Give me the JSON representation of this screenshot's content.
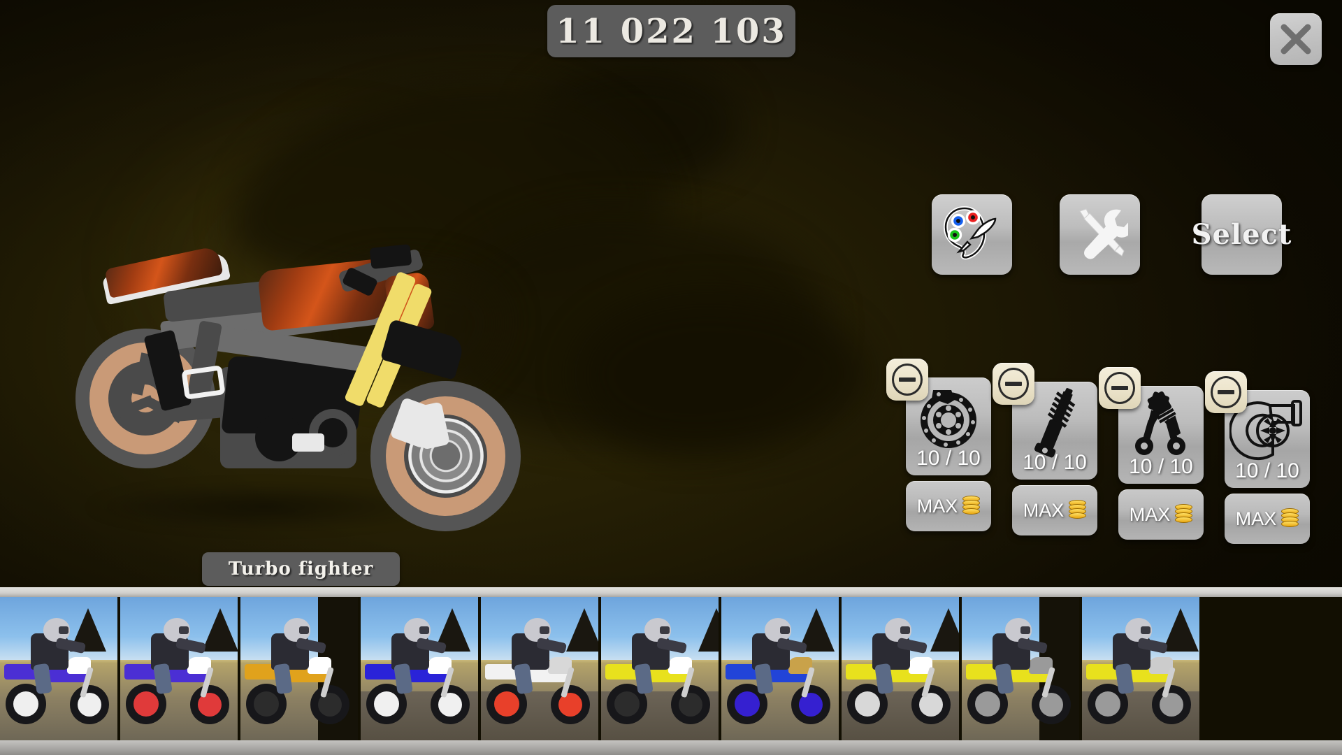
{
  "hud": {
    "money_counter": "11 022 103",
    "close_icon": "close-icon"
  },
  "actions": [
    {
      "id": "paint",
      "name": "paint-button",
      "label": "",
      "icon": "paint-palette-icon"
    },
    {
      "id": "tools",
      "name": "tools-button",
      "label": "",
      "icon": "tools-wrench-screwdriver-icon"
    },
    {
      "id": "select",
      "name": "select-button",
      "label": "Select",
      "icon": ""
    }
  ],
  "upgrades": {
    "decrement_icon": "minus-icon",
    "currency_icon": "coin-stack-icon",
    "items": [
      {
        "name": "brakes",
        "icon": "brake-disc-icon",
        "level": "10 / 10",
        "buy_label": "MAX"
      },
      {
        "name": "suspension",
        "icon": "shock-absorber-icon",
        "level": "10 / 10",
        "buy_label": "MAX"
      },
      {
        "name": "engine",
        "icon": "pistons-icon",
        "level": "10 / 10",
        "buy_label": "MAX"
      },
      {
        "name": "turbo",
        "icon": "turbocharger-icon",
        "level": "10 / 10",
        "buy_label": "MAX"
      }
    ]
  },
  "vehicle": {
    "name": "Turbo  fighter"
  },
  "garage_strip": {
    "thumbnails": [
      {
        "index": 1,
        "bike_color": "#4b2fd4",
        "accent": "#ffffff",
        "rim": "#efefef",
        "scene": "desert-day",
        "selected": false
      },
      {
        "index": 2,
        "bike_color": "#4b2fd4",
        "accent": "#ffffff",
        "rim": "#e03a3a",
        "scene": "desert-day",
        "selected": false
      },
      {
        "index": 3,
        "bike_color": "#e0a21c",
        "accent": "#ffffff",
        "rim": "#2c2c2c",
        "scene": "desert-wall",
        "selected": false
      },
      {
        "index": 4,
        "bike_color": "#2a23d8",
        "accent": "#ffffff",
        "rim": "#f0f0f0",
        "scene": "desert-road",
        "selected": false
      },
      {
        "index": 5,
        "bike_color": "#f2f2f2",
        "accent": "#d8d8d8",
        "rim": "#e8402a",
        "scene": "desert-road",
        "selected": false
      },
      {
        "index": 6,
        "bike_color": "#e8e11d",
        "accent": "#ffffff",
        "rim": "#2c2c2c",
        "scene": "desert-road",
        "selected": false
      },
      {
        "index": 7,
        "bike_color": "#2244d8",
        "accent": "#c9a24a",
        "rim": "#3520d0",
        "scene": "desert-day",
        "selected": false
      },
      {
        "index": 8,
        "bike_color": "#e8e11d",
        "accent": "#ffffff",
        "rim": "#d8d8d8",
        "scene": "desert-road",
        "selected": false
      },
      {
        "index": 9,
        "bike_color": "#e8e11d",
        "accent": "#9a9a9a",
        "rim": "#9a9a9a",
        "scene": "desert-wall",
        "selected": false
      },
      {
        "index": 10,
        "bike_color": "#e8e11d",
        "accent": "#cccccc",
        "rim": "#9a9a9a",
        "scene": "desert-road",
        "selected": false
      }
    ]
  },
  "theme": {
    "background": "#241f06",
    "panel_grey": "#b8b8b8",
    "counter_bg": "#5c5c5c",
    "text_light": "#ffffff",
    "minus_btn": "#ece4cb",
    "coin_gold": "#e8a712"
  }
}
